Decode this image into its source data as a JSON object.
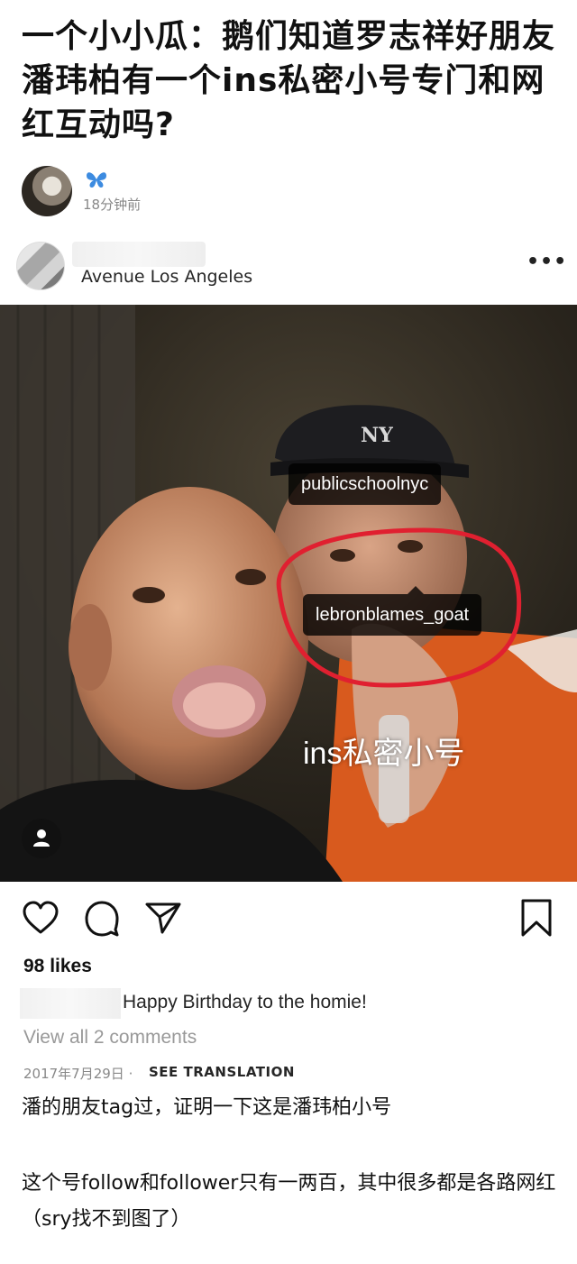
{
  "article": {
    "title": "一个小小瓜：鹅们知道罗志祥好朋友潘玮柏有一个ins私密小号专门和网红互动吗?",
    "time": "18分钟前",
    "paragraphs": [
      "潘的朋友tag过，证明一下这是潘玮柏小号",
      "这个号follow和follower只有一两百，其中很多都是各路网红（sry找不到图了）"
    ]
  },
  "ig_post": {
    "location": "Avenue Los Angeles",
    "more_label": "•••",
    "tags": [
      "publicschoolnyc",
      "lebronblames_goat"
    ],
    "overlay_text": "ins私密小号",
    "likes": "98 likes",
    "caption": "Happy Birthday to the homie!",
    "view_comments": "View all 2 comments",
    "date": "2017年7月29日 ·",
    "see_translation": "SEE TRANSLATION"
  },
  "colors": {
    "highlight_circle": "#e02030",
    "tag_bg": "#000000",
    "orange_jacket": "#d85a1e"
  },
  "icons": [
    "butterfly-icon",
    "more-options-icon",
    "user-tag-icon",
    "heart-icon",
    "comment-icon",
    "share-icon",
    "bookmark-icon"
  ]
}
